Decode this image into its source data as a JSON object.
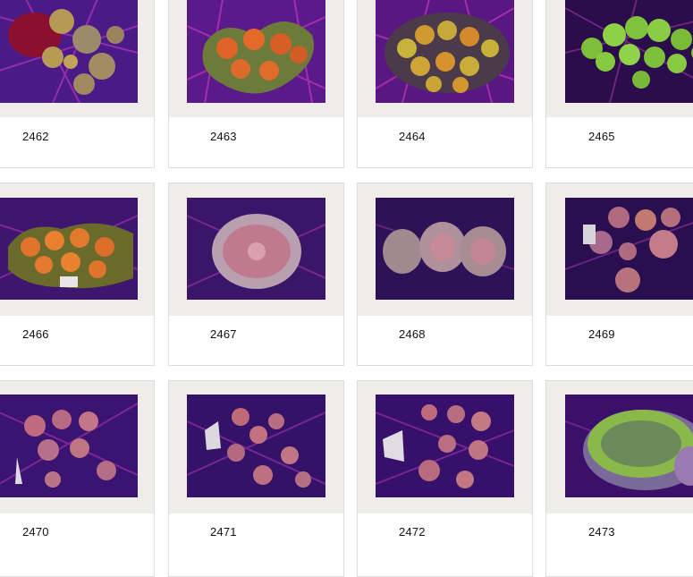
{
  "gallery": {
    "items": [
      {
        "id": "2462",
        "coral": "mixed-rhodactis-1"
      },
      {
        "id": "2463",
        "coral": "orange-green-rhodactis"
      },
      {
        "id": "2464",
        "coral": "orange-green-rhodactis-2"
      },
      {
        "id": "2465",
        "coral": "green-rhodactis"
      },
      {
        "id": "2466",
        "coral": "orange-rhodactis-colony"
      },
      {
        "id": "2467",
        "coral": "bubble-rhodactis"
      },
      {
        "id": "2468",
        "coral": "bubble-rhodactis-2"
      },
      {
        "id": "2469",
        "coral": "purple-rhodactis"
      },
      {
        "id": "2470",
        "coral": "purple-rhodactis-2"
      },
      {
        "id": "2471",
        "coral": "purple-rhodactis-3"
      },
      {
        "id": "2472",
        "coral": "purple-rhodactis-4"
      },
      {
        "id": "2473",
        "coral": "green-hairy-mushroom"
      }
    ]
  },
  "colors": {
    "background": "#ffffff",
    "thumb_frame": "#efedea",
    "card_border": "#dcdcdc",
    "label_text": "#111111"
  }
}
